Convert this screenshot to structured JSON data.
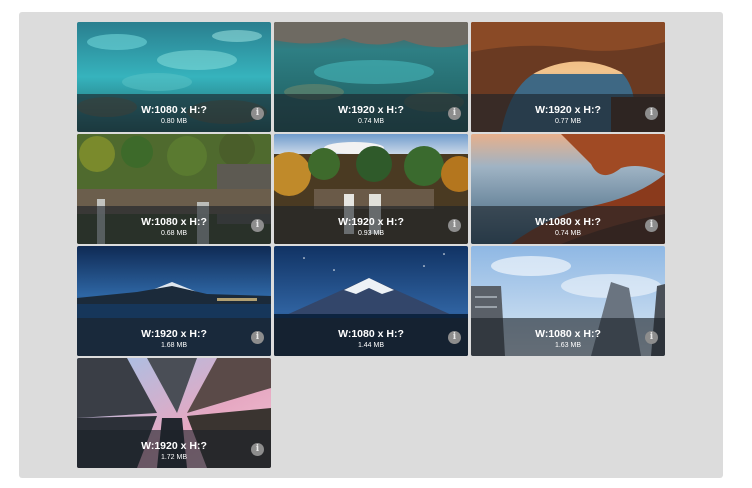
{
  "gallery": {
    "info_glyph": "i",
    "items": [
      {
        "scene": "turquoise-water-rocks",
        "dims": "W:1080 x H:?",
        "size": "0.80 MB"
      },
      {
        "scene": "rocky-shore-clear-water",
        "dims": "W:1920 x H:?",
        "size": "0.74 MB"
      },
      {
        "scene": "sea-cave-arch-sunset",
        "dims": "W:1920 x H:?",
        "size": "0.77 MB"
      },
      {
        "scene": "forest-waterfall-cliff",
        "dims": "W:1080 x H:?",
        "size": "0.68 MB"
      },
      {
        "scene": "autumn-waterfall",
        "dims": "W:1920 x H:?",
        "size": "0.93 MB"
      },
      {
        "scene": "coastal-rock-arch",
        "dims": "W:1080 x H:?",
        "size": "0.74 MB"
      },
      {
        "scene": "mountain-lake-night",
        "dims": "W:1920 x H:?",
        "size": "1.68 MB"
      },
      {
        "scene": "snowcap-mountain-night",
        "dims": "W:1080 x H:?",
        "size": "1.44 MB"
      },
      {
        "scene": "skyscrapers-blue-sky",
        "dims": "W:1080 x H:?",
        "size": "1.63 MB"
      },
      {
        "scene": "skyscrapers-pink-sky-looking-up",
        "dims": "W:1920 x H:?",
        "size": "1.72 MB"
      }
    ]
  }
}
